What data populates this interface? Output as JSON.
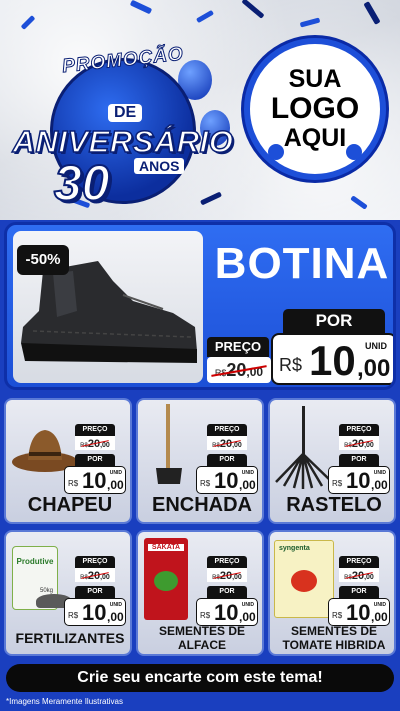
{
  "header": {
    "badge_arc": "PROMOÇÃO",
    "badge_de": "DE",
    "badge_main": "ANIVERSÁRIO",
    "badge_number": "30",
    "badge_anos": "ANOS",
    "logo_line1": "SUA",
    "logo_line2": "LOGO",
    "logo_line3": "AQUI"
  },
  "featured": {
    "discount": "-50%",
    "name": "BOTINA",
    "preco_label": "PREÇO",
    "old_currency": "R$",
    "old_int": "20",
    "old_dec": ",00",
    "por_label": "POR",
    "unid_label": "UNID",
    "currency": "R$",
    "price_int": "10",
    "price_dec": ",00"
  },
  "products": [
    {
      "name": "CHAPEU",
      "preco_label": "PREÇO",
      "old_currency": "R$",
      "old_int": "20",
      "old_dec": ",00",
      "por_label": "POR",
      "unid": "UNID",
      "currency": "R$",
      "price_int": "10",
      "price_dec": ",00"
    },
    {
      "name": "ENCHADA",
      "preco_label": "PREÇO",
      "old_currency": "R$",
      "old_int": "20",
      "old_dec": ",00",
      "por_label": "POR",
      "unid": "UNID",
      "currency": "R$",
      "price_int": "10",
      "price_dec": ",00"
    },
    {
      "name": "RASTELO",
      "preco_label": "PREÇO",
      "old_currency": "R$",
      "old_int": "20",
      "old_dec": ",00",
      "por_label": "POR",
      "unid": "UNID",
      "currency": "R$",
      "price_int": "10",
      "price_dec": ",00"
    },
    {
      "name": "FERTILIZANTES",
      "preco_label": "PREÇO",
      "old_currency": "R$",
      "old_int": "20",
      "old_dec": ",00",
      "por_label": "POR",
      "unid": "UNID",
      "currency": "R$",
      "price_int": "10",
      "price_dec": ",00"
    },
    {
      "name": "SEMENTES DE",
      "name2": "ALFACE",
      "preco_label": "PREÇO",
      "old_currency": "R$",
      "old_int": "20",
      "old_dec": ",00",
      "por_label": "POR",
      "unid": "UNID",
      "currency": "R$",
      "price_int": "10",
      "price_dec": ",00"
    },
    {
      "name": "SEMENTES DE",
      "name2": "TOMATE HIBRIDA",
      "preco_label": "PREÇO",
      "old_currency": "R$",
      "old_int": "20",
      "old_dec": ",00",
      "por_label": "POR",
      "unid": "UNID",
      "currency": "R$",
      "price_int": "10",
      "price_dec": ",00"
    }
  ],
  "product_images": {
    "fertilizer_brand": "Produtive",
    "fertilizer_weight": "50kg",
    "lettuce_brand": "SAKATA",
    "tomato_brand": "syngenta"
  },
  "footer": {
    "cta": "Crie seu encarte com este tema!",
    "disclaimer": "*Imagens Meramente Ilustrativas"
  },
  "colors": {
    "primary_blue": "#1c4fd6",
    "dark_blue": "#0a1f74",
    "black": "#111111",
    "strike_red": "#cc0000"
  }
}
